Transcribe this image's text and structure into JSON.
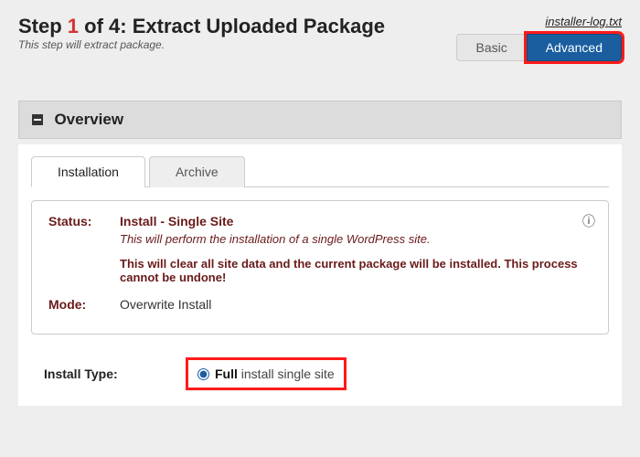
{
  "header": {
    "step_prefix": "Step ",
    "step_num": "1",
    "step_suffix": " of 4: Extract Uploaded Package",
    "subtitle": "This step will extract package.",
    "log_link": "installer-log.txt",
    "basic_label": "Basic",
    "advanced_label": "Advanced"
  },
  "overview": {
    "title": "Overview"
  },
  "tabs": {
    "installation": "Installation",
    "archive": "Archive"
  },
  "panel": {
    "status_label": "Status:",
    "status_value": "Install - Single Site",
    "status_desc": "This will perform the installation of a single WordPress site.",
    "status_warn": "This will clear all site data and the current package will be installed. This process cannot be undone!",
    "mode_label": "Mode:",
    "mode_value": "Overwrite Install",
    "help_icon": "?"
  },
  "install_type": {
    "label": "Install Type:",
    "option_bold": "Full",
    "option_rest": " install single site"
  }
}
